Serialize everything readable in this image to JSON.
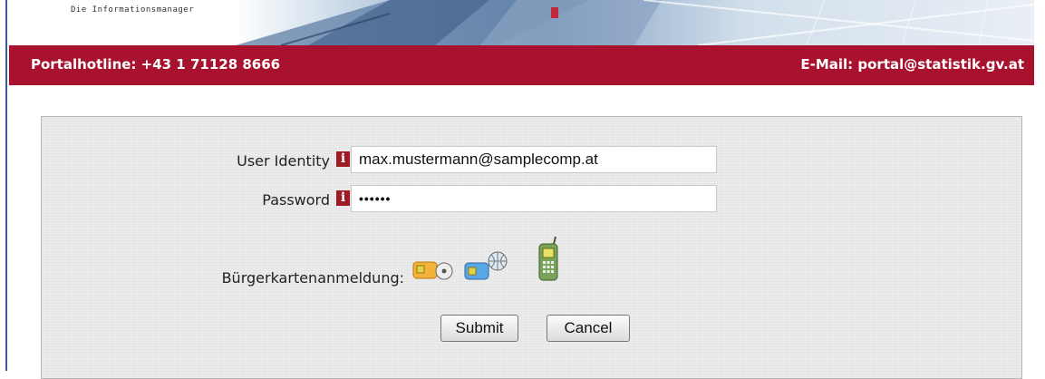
{
  "banner": {
    "tagline": "Die Informationsmanager"
  },
  "contact": {
    "hotline": "Portalhotline: +43 1 71128 8666",
    "email": "E-Mail: portal@statistik.gv.at"
  },
  "login": {
    "user_identity_label": "User Identity",
    "user_identity_value": "max.mustermann@samplecomp.at",
    "password_label": "Password",
    "password_value": "••••••",
    "info_glyph": "i",
    "buergerkarte_label": "Bürgerkartenanmeldung:",
    "card_options": [
      "card-reader-cd-icon",
      "online-card-icon",
      "mobile-phone-signature-icon"
    ],
    "submit_label": "Submit",
    "cancel_label": "Cancel"
  },
  "colors": {
    "brand_red": "#a8122e",
    "info_red": "#9e1b24",
    "panel_bg": "#ececec"
  }
}
